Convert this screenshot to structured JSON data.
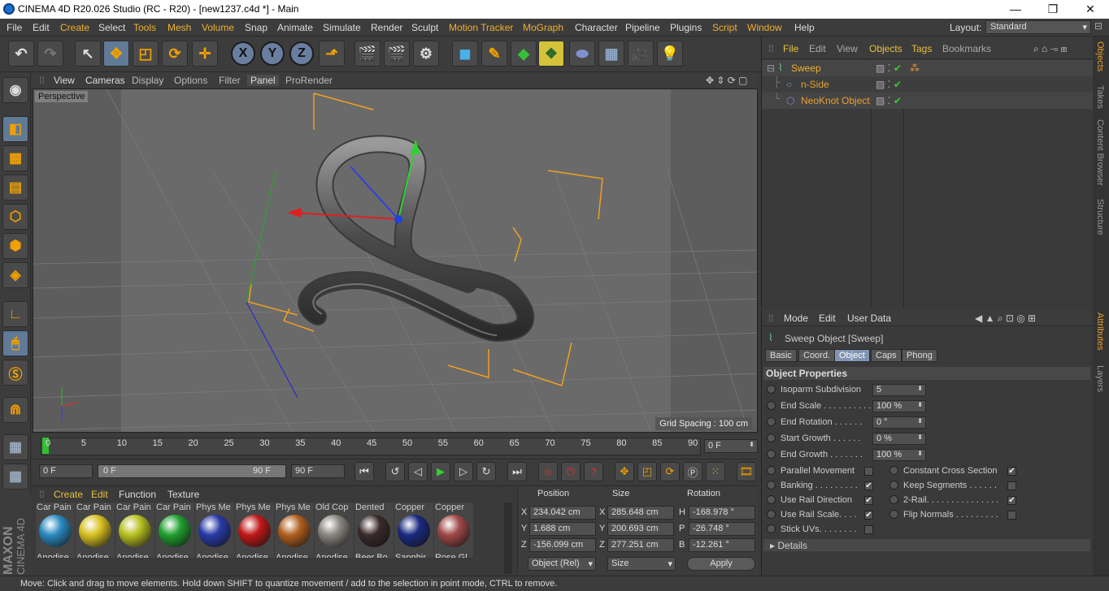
{
  "window": {
    "title": "CINEMA 4D R20.026 Studio (RC - R20) - [new1237.c4d *] - Main",
    "minimize": "—",
    "maximize": "❐",
    "close": "✕"
  },
  "menu": {
    "items": [
      "File",
      "Edit",
      "Create",
      "Select",
      "Tools",
      "Mesh",
      "Volume",
      "Snap",
      "Animate",
      "Simulate",
      "Render",
      "Sculpt",
      "Motion Tracker",
      "MoGraph",
      "Character",
      "Pipeline",
      "Plugins",
      "Script",
      "Window",
      "Help"
    ],
    "layout_label": "Layout:",
    "layout_value": "Standard"
  },
  "viewport": {
    "menu": [
      "View",
      "Cameras",
      "Display",
      "Options",
      "Filter",
      "Panel",
      "ProRender"
    ],
    "camera": "Perspective",
    "grid_spacing": "Grid Spacing : 100 cm"
  },
  "timeline": {
    "ticks": [
      "0",
      "5",
      "10",
      "15",
      "20",
      "25",
      "30",
      "35",
      "40",
      "45",
      "50",
      "55",
      "60",
      "65",
      "70",
      "75",
      "80",
      "85",
      "90"
    ],
    "current_frame": "0 F"
  },
  "transport": {
    "start": "0 F",
    "range_start": "0 F",
    "range_end": "90 F",
    "end": "90 F"
  },
  "materials": {
    "menu": [
      "Create",
      "Edit",
      "Function",
      "Texture"
    ],
    "items": [
      {
        "top": "Car Pain",
        "name": "Anodise",
        "color": "#2a8ac0"
      },
      {
        "top": "Car Pain",
        "name": "Anodise",
        "color": "#d8c020"
      },
      {
        "top": "Car Pain",
        "name": "Anodise",
        "color": "#b8c020"
      },
      {
        "top": "Car Pain",
        "name": "Anodise",
        "color": "#20a030"
      },
      {
        "top": "Phys Me",
        "name": "Anodise",
        "color": "#2a3aa8"
      },
      {
        "top": "Phys Me",
        "name": "Anodise",
        "color": "#c01818"
      },
      {
        "top": "Phys Me",
        "name": "Anodise",
        "color": "#b06020"
      },
      {
        "top": "Old Cop",
        "name": "Anodise",
        "color": "#8a8680"
      },
      {
        "top": "Dented",
        "name": "Beer Bo",
        "color": "#3a2a2a"
      },
      {
        "top": "Copper",
        "name": "Sapphir",
        "color": "#1a2a80"
      },
      {
        "top": "Copper",
        "name": "Rose Gl",
        "color": "#a04848"
      }
    ]
  },
  "coords": {
    "headers": [
      "Position",
      "Size",
      "Rotation"
    ],
    "rows": [
      {
        "axis": "X",
        "pos": "234.042 cm",
        "saxis": "X",
        "size": "285.648 cm",
        "raxis": "H",
        "rot": "-168.978 °"
      },
      {
        "axis": "Y",
        "pos": "1.688 cm",
        "saxis": "Y",
        "size": "200.693 cm",
        "raxis": "P",
        "rot": "-26.748 °"
      },
      {
        "axis": "Z",
        "pos": "-156.099 cm",
        "saxis": "Z",
        "size": "277.251 cm",
        "raxis": "B",
        "rot": "-12.261 °"
      }
    ],
    "mode": "Object (Rel)",
    "size_mode": "Size",
    "apply": "Apply"
  },
  "objects": {
    "menu": [
      "File",
      "Edit",
      "View",
      "Objects",
      "Tags",
      "Bookmarks"
    ],
    "tree": [
      {
        "name": "Sweep"
      },
      {
        "name": "n-Side"
      },
      {
        "name": "NeoKnot Object"
      }
    ]
  },
  "attributes": {
    "menu": [
      "Mode",
      "Edit",
      "User Data"
    ],
    "title": "Sweep Object [Sweep]",
    "tabs": [
      "Basic",
      "Coord.",
      "Object",
      "Caps",
      "Phong"
    ],
    "section": "Object Properties",
    "fields": [
      {
        "label": "Isoparm Subdivision",
        "value": "5"
      },
      {
        "label": "End Scale . . . . . . . . . .",
        "value": "100 %"
      },
      {
        "label": "End Rotation . . . . . .",
        "value": "0 °"
      },
      {
        "label": "Start Growth . . . . . .",
        "value": "0 %"
      },
      {
        "label": "End Growth . . . . . . .",
        "value": "100 %"
      }
    ],
    "checks_left": [
      {
        "label": "Parallel Movement",
        "checked": ""
      },
      {
        "label": "Banking . . . . . . . . .",
        "checked": "✔"
      },
      {
        "label": "Use Rail Direction",
        "checked": "✔"
      },
      {
        "label": "Use Rail Scale. . . .",
        "checked": "✔"
      },
      {
        "label": "Stick UVs. . . . . . . .",
        "checked": ""
      }
    ],
    "checks_right": [
      {
        "label": "Constant Cross Section",
        "checked": "✔"
      },
      {
        "label": "Keep Segments . . . . . .",
        "checked": ""
      },
      {
        "label": "2-Rail. . . . . . . . . . . . . . .",
        "checked": "✔"
      },
      {
        "label": "Flip Normals . . . . . . . . .",
        "checked": ""
      }
    ],
    "details": "Details"
  },
  "right_tabs": [
    "Objects",
    "Takes",
    "Content Browser",
    "Structure",
    "Attributes",
    "Layers"
  ],
  "status": "Move: Click and drag to move elements. Hold down SHIFT to quantize movement / add to the selection in point mode, CTRL to remove.",
  "maxon": {
    "brand": "MAXON",
    "product": "CINEMA 4D"
  }
}
